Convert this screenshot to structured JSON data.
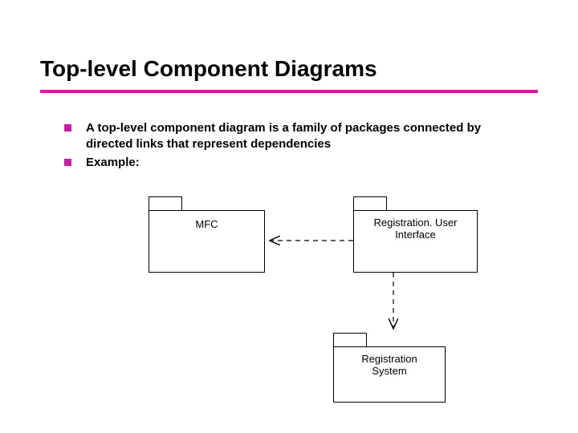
{
  "title": "Top-level Component Diagrams",
  "bullets": [
    {
      "prefix": "A ",
      "bold": "top-level component diagram",
      "suffix": " is a family of packages connected by directed links that represent dependencies"
    },
    {
      "prefix": "Example:",
      "bold": "",
      "suffix": ""
    }
  ],
  "packages": {
    "mfc": "MFC",
    "regUI_line1": "Registration. User",
    "regUI_line2": "Interface",
    "regSys_line1": "Registration",
    "regSys_line2": "System"
  },
  "colors": {
    "accent": "#c81fa0"
  },
  "chart_data": {
    "type": "diagram",
    "diagram_kind": "uml-package-dependency",
    "title": "Top-level Component Diagrams",
    "nodes": [
      {
        "id": "MFC",
        "label": "MFC"
      },
      {
        "id": "RegistrationUserInterface",
        "label": "Registration. User Interface"
      },
      {
        "id": "RegistrationSystem",
        "label": "Registration System"
      }
    ],
    "edges": [
      {
        "from": "RegistrationUserInterface",
        "to": "MFC",
        "style": "dashed",
        "meaning": "depends-on"
      },
      {
        "from": "RegistrationUserInterface",
        "to": "RegistrationSystem",
        "style": "dashed",
        "meaning": "depends-on"
      }
    ]
  }
}
